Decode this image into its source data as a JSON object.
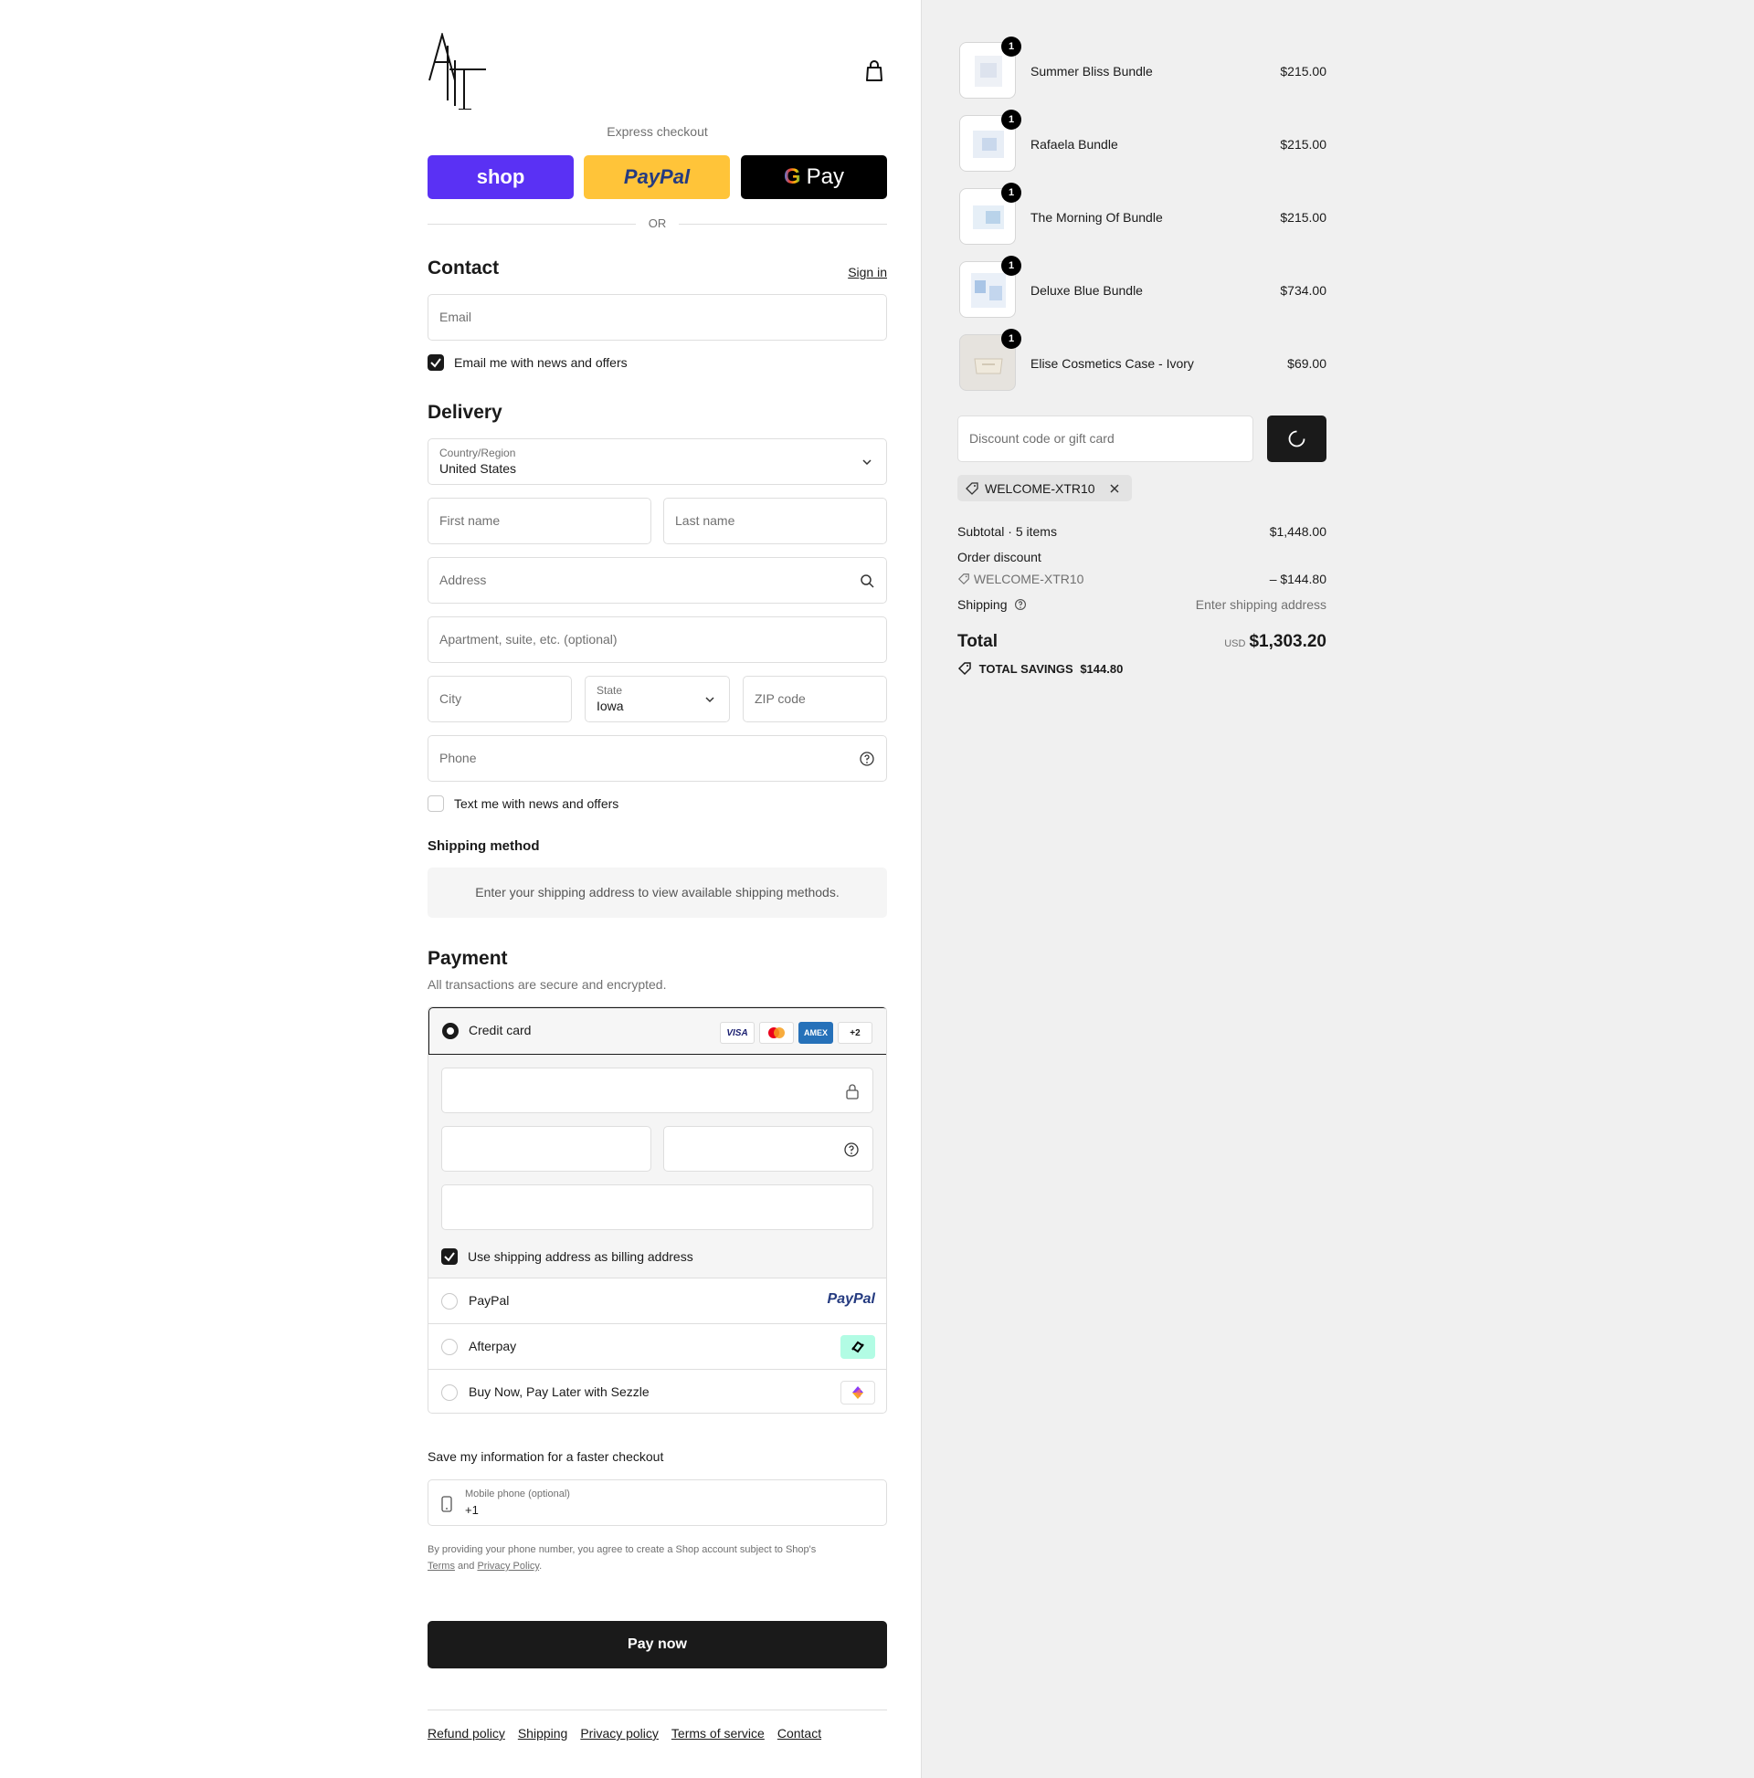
{
  "brand": {
    "logo_text": "ALT"
  },
  "express": {
    "label": "Express checkout",
    "shop_label": "shop",
    "paypal_label": "PayPal",
    "gpay_label": "Pay",
    "or_label": "OR"
  },
  "contact": {
    "heading": "Contact",
    "sign_in": "Sign in",
    "email_placeholder": "Email",
    "news_checkbox_label": "Email me with news and offers",
    "news_checked": true
  },
  "delivery": {
    "heading": "Delivery",
    "country_label": "Country/Region",
    "country_value": "United States",
    "first_name_placeholder": "First name",
    "last_name_placeholder": "Last name",
    "address_placeholder": "Address",
    "apartment_placeholder": "Apartment, suite, etc. (optional)",
    "city_placeholder": "City",
    "state_label": "State",
    "state_value": "Iowa",
    "zip_placeholder": "ZIP code",
    "phone_placeholder": "Phone",
    "text_checkbox_label": "Text me with news and offers",
    "text_checked": false
  },
  "shipping_method": {
    "heading": "Shipping method",
    "message": "Enter your shipping address to view available shipping methods."
  },
  "payment": {
    "heading": "Payment",
    "subtitle": "All transactions are secure and encrypted.",
    "credit_card_label": "Credit card",
    "card_badges": [
      "VISA",
      "MC",
      "AMEX",
      "+2"
    ],
    "billing_checkbox_label": "Use shipping address as billing address",
    "billing_checked": true,
    "methods": [
      {
        "label": "PayPal",
        "logo": "PayPal"
      },
      {
        "label": "Afterpay",
        "logo": "afterpay-icon"
      },
      {
        "label": "Buy Now, Pay Later with Sezzle",
        "logo": "sezzle-icon"
      }
    ]
  },
  "save_info": {
    "heading": "Save my information for a faster checkout",
    "mobile_label": "Mobile phone (optional)",
    "mobile_value": "+1",
    "disclaimer_prefix": "By providing your phone number, you agree to create a Shop account subject to Shop's",
    "terms_link": "Terms",
    "and_text": "and",
    "privacy_link": "Privacy Policy",
    "period": "."
  },
  "pay_now_label": "Pay now",
  "footer_links": [
    "Refund policy",
    "Shipping",
    "Privacy policy",
    "Terms of service",
    "Contact"
  ],
  "cart": {
    "items": [
      {
        "name": "Summer Bliss Bundle",
        "price": "$215.00",
        "qty": "1"
      },
      {
        "name": "Rafaela Bundle",
        "price": "$215.00",
        "qty": "1"
      },
      {
        "name": "The Morning Of Bundle",
        "price": "$215.00",
        "qty": "1"
      },
      {
        "name": "Deluxe Blue Bundle",
        "price": "$734.00",
        "qty": "1"
      },
      {
        "name": "Elise Cosmetics Case - Ivory",
        "price": "$69.00",
        "qty": "1"
      }
    ],
    "discount_placeholder": "Discount code or gift card",
    "applied_code": "WELCOME-XTR10",
    "subtotal_label": "Subtotal · 5 items",
    "subtotal_value": "$1,448.00",
    "order_discount_label": "Order discount",
    "discount_code": "WELCOME-XTR10",
    "discount_value": "– $144.80",
    "shipping_label": "Shipping",
    "shipping_value": "Enter shipping address",
    "total_label": "Total",
    "currency": "USD",
    "total_value": "$1,303.20",
    "savings_label": "TOTAL SAVINGS",
    "savings_value": "$144.80"
  },
  "colors": {
    "shop_purple": "#5a31f4",
    "paypal_yellow": "#ffc439",
    "dark": "#1a1a1a",
    "sidebar_bg": "#f0f0f0"
  }
}
